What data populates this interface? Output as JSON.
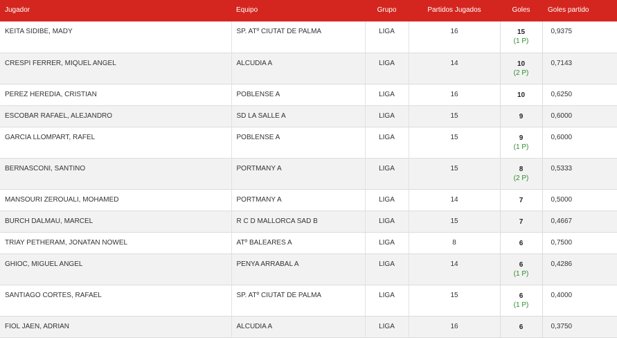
{
  "headers": {
    "jugador": "Jugador",
    "equipo": "Equipo",
    "grupo": "Grupo",
    "partidos": "Partidos Jugados",
    "goles": "Goles",
    "goles_partido": "Goles partido"
  },
  "rows": [
    {
      "jugador": "KEITA SIDIBE, MADY",
      "equipo": "SP. ATº CIUTAT DE PALMA",
      "grupo": "LIGA",
      "partidos": "16",
      "goles": "15",
      "penaltis": "(1 P)",
      "goles_partido": "0,9375"
    },
    {
      "jugador": "CRESPI FERRER, MIQUEL ANGEL",
      "equipo": "ALCUDIA A",
      "grupo": "LIGA",
      "partidos": "14",
      "goles": "10",
      "penaltis": "(2 P)",
      "goles_partido": "0,7143"
    },
    {
      "jugador": "PEREZ HEREDIA, CRISTIAN",
      "equipo": "POBLENSE A",
      "grupo": "LIGA",
      "partidos": "16",
      "goles": "10",
      "penaltis": "",
      "goles_partido": "0,6250"
    },
    {
      "jugador": "ESCOBAR RAFAEL, ALEJANDRO",
      "equipo": "SD LA SALLE A",
      "grupo": "LIGA",
      "partidos": "15",
      "goles": "9",
      "penaltis": "",
      "goles_partido": "0,6000"
    },
    {
      "jugador": "GARCIA LLOMPART, RAFEL",
      "equipo": "POBLENSE A",
      "grupo": "LIGA",
      "partidos": "15",
      "goles": "9",
      "penaltis": "(1 P)",
      "goles_partido": "0,6000"
    },
    {
      "jugador": "BERNASCONI, SANTINO",
      "equipo": "PORTMANY A",
      "grupo": "LIGA",
      "partidos": "15",
      "goles": "8",
      "penaltis": "(2 P)",
      "goles_partido": "0,5333"
    },
    {
      "jugador": "MANSOURI ZEROUALI, MOHAMED",
      "equipo": "PORTMANY A",
      "grupo": "LIGA",
      "partidos": "14",
      "goles": "7",
      "penaltis": "",
      "goles_partido": "0,5000"
    },
    {
      "jugador": "BURCH DALMAU, MARCEL",
      "equipo": "R C D MALLORCA SAD B",
      "grupo": "LIGA",
      "partidos": "15",
      "goles": "7",
      "penaltis": "",
      "goles_partido": "0,4667"
    },
    {
      "jugador": "TRIAY PETHERAM, JONATAN NOWEL",
      "equipo": "ATº BALEARES A",
      "grupo": "LIGA",
      "partidos": "8",
      "goles": "6",
      "penaltis": "",
      "goles_partido": "0,7500"
    },
    {
      "jugador": "GHIOC, MIGUEL ANGEL",
      "equipo": "PENYA ARRABAL A",
      "grupo": "LIGA",
      "partidos": "14",
      "goles": "6",
      "penaltis": "(1 P)",
      "goles_partido": "0,4286"
    },
    {
      "jugador": "SANTIAGO CORTES, RAFAEL",
      "equipo": "SP. ATº CIUTAT DE PALMA",
      "grupo": "LIGA",
      "partidos": "15",
      "goles": "6",
      "penaltis": "(1 P)",
      "goles_partido": "0,4000"
    },
    {
      "jugador": "FIOL JAEN, ADRIAN",
      "equipo": "ALCUDIA A",
      "grupo": "LIGA",
      "partidos": "16",
      "goles": "6",
      "penaltis": "",
      "goles_partido": "0,3750"
    }
  ]
}
